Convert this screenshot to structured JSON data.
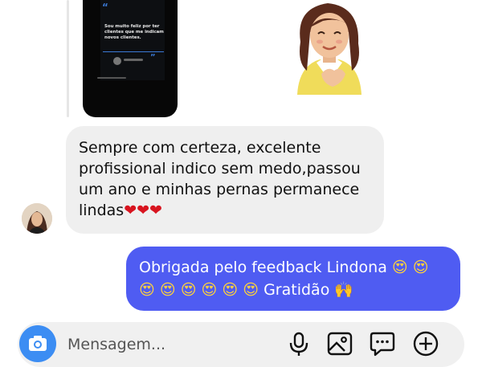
{
  "story_preview": {
    "quote_text": "Sou muito feliz por ter clientes que me indicam novos clientes.",
    "open_quote": "“",
    "close_quote": "”"
  },
  "sticker": {
    "icon": "memoji-heart-sticker-icon"
  },
  "received_message": {
    "text": "Sempre com certeza, excelente profissional indico sem medo,passou um ano e minhas pernas permanece lindas",
    "emojis": "❤❤❤"
  },
  "sent_message": {
    "text_start": "Obrigada pelo feedback Lindona ",
    "heart_eyes": "😍 😍 😍 😍 😍 😍 😍 😍",
    "gratitude": " Gratidão ",
    "hands": "🙌"
  },
  "composer": {
    "placeholder": "Mensagem...",
    "icons": [
      "camera-icon",
      "microphone-icon",
      "image-icon",
      "sticker-chat-icon",
      "plus-icon"
    ]
  },
  "colors": {
    "sent_bubble": "#4f5cf2",
    "received_bubble": "#efefef",
    "camera_button": "#3c8df3"
  }
}
